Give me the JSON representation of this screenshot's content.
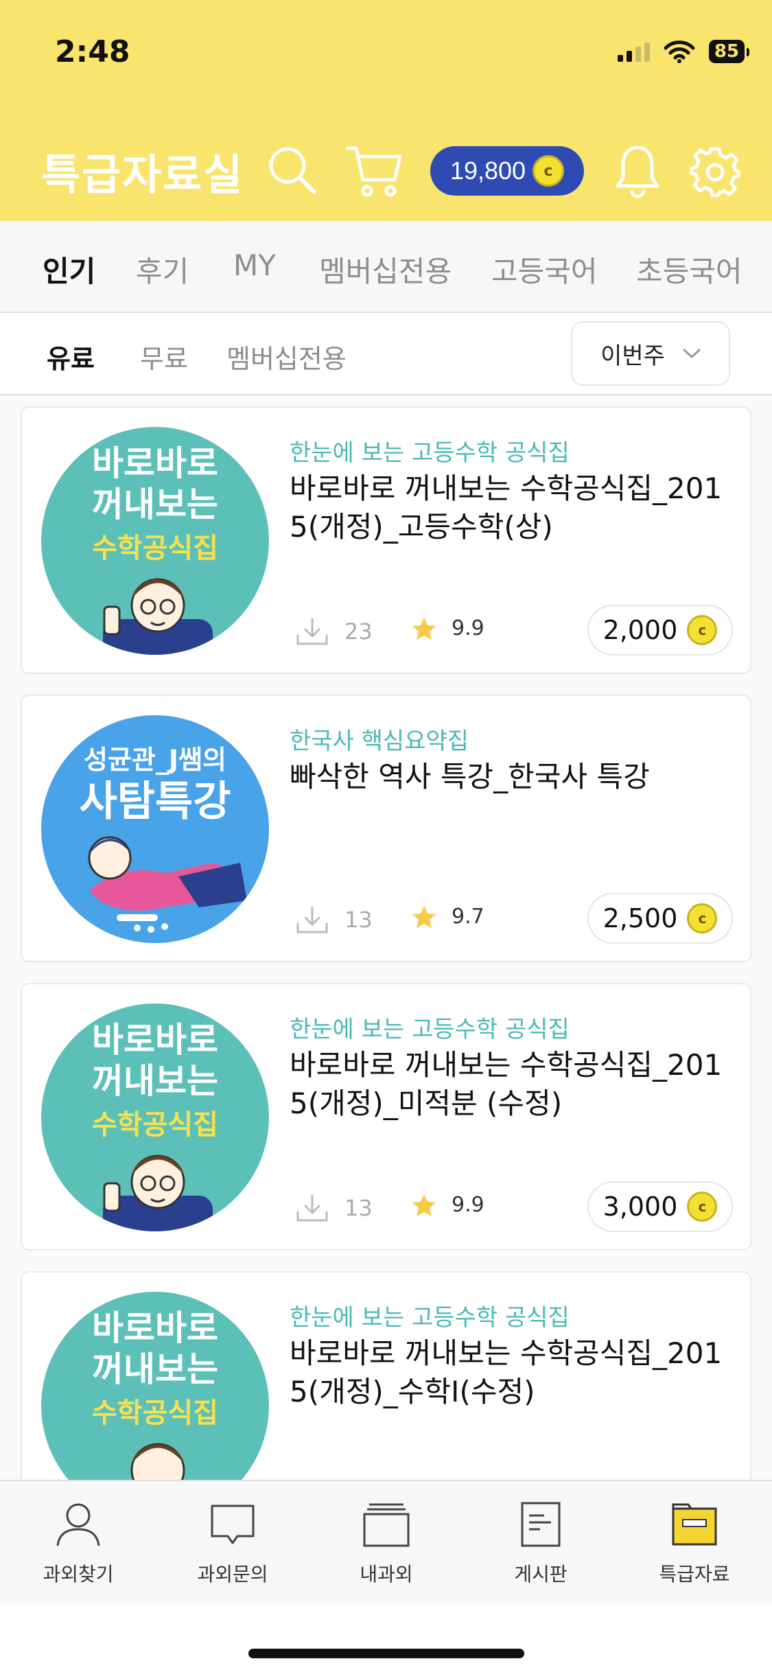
{
  "status": {
    "time": "2:48",
    "battery": "85"
  },
  "header": {
    "title": "특급자료실",
    "coins": "19,800",
    "coin_symbol": "c"
  },
  "tabs": [
    "인기",
    "후기",
    "MY",
    "멤버십전용",
    "고등국어",
    "초등국어"
  ],
  "subtabs": [
    "유료",
    "무료",
    "멤버십전용"
  ],
  "period_select": "이번주",
  "items": [
    {
      "thumb": "math",
      "thumb_lines": [
        "바로바로",
        "꺼내보는",
        "수학공식집"
      ],
      "category": "한눈에 보는 고등수학 공식집",
      "title": "바로바로 꺼내보는 수학공식집_2015(개정)_고등수학(상)",
      "downloads": "23",
      "rating": "9.9",
      "price": "2,000"
    },
    {
      "thumb": "history",
      "thumb_lines": [
        "성균관_J쌤의",
        "사탐특강"
      ],
      "category": "한국사 핵심요약집",
      "title": "빠삭한 역사 특강_한국사 특강",
      "downloads": "13",
      "rating": "9.7",
      "price": "2,500"
    },
    {
      "thumb": "math",
      "thumb_lines": [
        "바로바로",
        "꺼내보는",
        "수학공식집"
      ],
      "category": "한눈에 보는 고등수학 공식집",
      "title": "바로바로 꺼내보는 수학공식집_2015(개정)_미적분 (수정)",
      "downloads": "13",
      "rating": "9.9",
      "price": "3,000"
    },
    {
      "thumb": "math",
      "thumb_lines": [
        "바로바로",
        "꺼내보는",
        "수학공식집"
      ],
      "category": "한눈에 보는 고등수학 공식집",
      "title": "바로바로 꺼내보는 수학공식집_2015(개정)_수학Ⅰ(수정)",
      "downloads": "",
      "rating": "",
      "price": ""
    }
  ],
  "bottom_nav": [
    {
      "label": "과외찾기",
      "icon": "person-icon"
    },
    {
      "label": "과외문의",
      "icon": "chat-icon"
    },
    {
      "label": "내과외",
      "icon": "stack-icon"
    },
    {
      "label": "게시판",
      "icon": "document-icon"
    },
    {
      "label": "특급자료",
      "icon": "folder-icon"
    }
  ],
  "colors": {
    "header_bg": "#f9e46d",
    "coin_pill": "#2d4bb3",
    "category_text": "#4bb9b5",
    "math_thumb": "#5cc0b9",
    "history_thumb": "#49a3e8"
  }
}
